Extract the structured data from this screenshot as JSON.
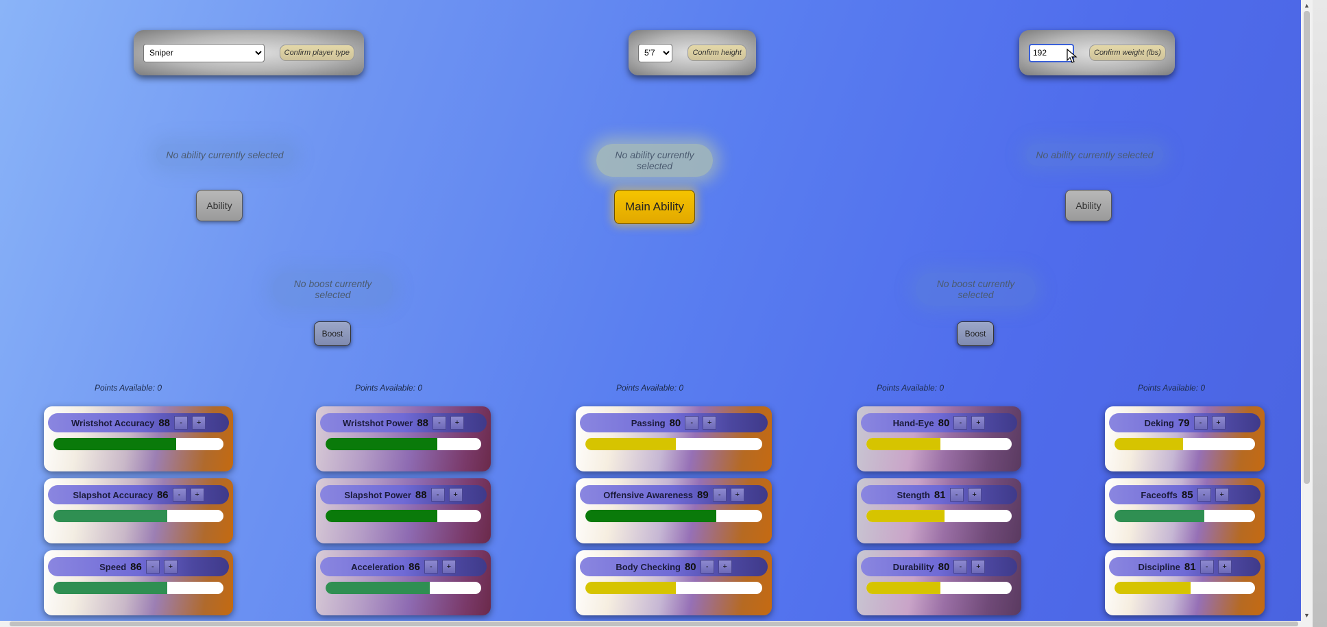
{
  "player_type": {
    "selected": "Sniper",
    "confirm_label": "Confirm player type"
  },
  "height": {
    "selected": "5'7",
    "confirm_label": "Confirm height"
  },
  "weight": {
    "value": "192",
    "confirm_label": "Confirm weight (lbs)"
  },
  "abilities": {
    "left": {
      "note": "No ability currently selected",
      "button": "Ability"
    },
    "main": {
      "note": "No ability currently selected",
      "button": "Main Ability"
    },
    "right": {
      "note": "No ability currently selected",
      "button": "Ability"
    }
  },
  "boosts": {
    "left": {
      "note": "No boost currently selected",
      "button": "Boost"
    },
    "right": {
      "note": "No boost currently selected",
      "button": "Boost"
    }
  },
  "points_label": "Points Available: 0",
  "stat_buttons": {
    "minus": "-",
    "plus": "+"
  },
  "colors": {
    "green_dark": "#0a7a0a",
    "green_light": "#2f8f52",
    "yellow": "#d6c400",
    "main_ability": "#f2c200"
  },
  "columns": [
    {
      "stats": [
        {
          "name": "Wristshot Accuracy",
          "value": "88",
          "fill": 0.72,
          "color": "#0a7a0a"
        },
        {
          "name": "Slapshot Accuracy",
          "value": "86",
          "fill": 0.67,
          "color": "#2f8f52"
        },
        {
          "name": "Speed",
          "value": "86",
          "fill": 0.67,
          "color": "#2f8f52"
        }
      ]
    },
    {
      "stats": [
        {
          "name": "Wristshot Power",
          "value": "88",
          "fill": 0.72,
          "color": "#0a7a0a"
        },
        {
          "name": "Slapshot Power",
          "value": "88",
          "fill": 0.72,
          "color": "#0a7a0a"
        },
        {
          "name": "Acceleration",
          "value": "86",
          "fill": 0.67,
          "color": "#2f8f52"
        }
      ]
    },
    {
      "stats": [
        {
          "name": "Passing",
          "value": "80",
          "fill": 0.51,
          "color": "#d6c400"
        },
        {
          "name": "Offensive Awareness",
          "value": "89",
          "fill": 0.74,
          "color": "#0a7a0a"
        },
        {
          "name": "Body Checking",
          "value": "80",
          "fill": 0.51,
          "color": "#d6c400"
        }
      ]
    },
    {
      "stats": [
        {
          "name": "Hand-Eye",
          "value": "80",
          "fill": 0.51,
          "color": "#d6c400"
        },
        {
          "name": "Stength",
          "value": "81",
          "fill": 0.54,
          "color": "#d6c400"
        },
        {
          "name": "Durability",
          "value": "80",
          "fill": 0.51,
          "color": "#d6c400"
        }
      ]
    },
    {
      "stats": [
        {
          "name": "Deking",
          "value": "79",
          "fill": 0.49,
          "color": "#d6c400"
        },
        {
          "name": "Faceoffs",
          "value": "85",
          "fill": 0.64,
          "color": "#2f8f52"
        },
        {
          "name": "Discipline",
          "value": "81",
          "fill": 0.54,
          "color": "#d6c400"
        }
      ]
    }
  ]
}
